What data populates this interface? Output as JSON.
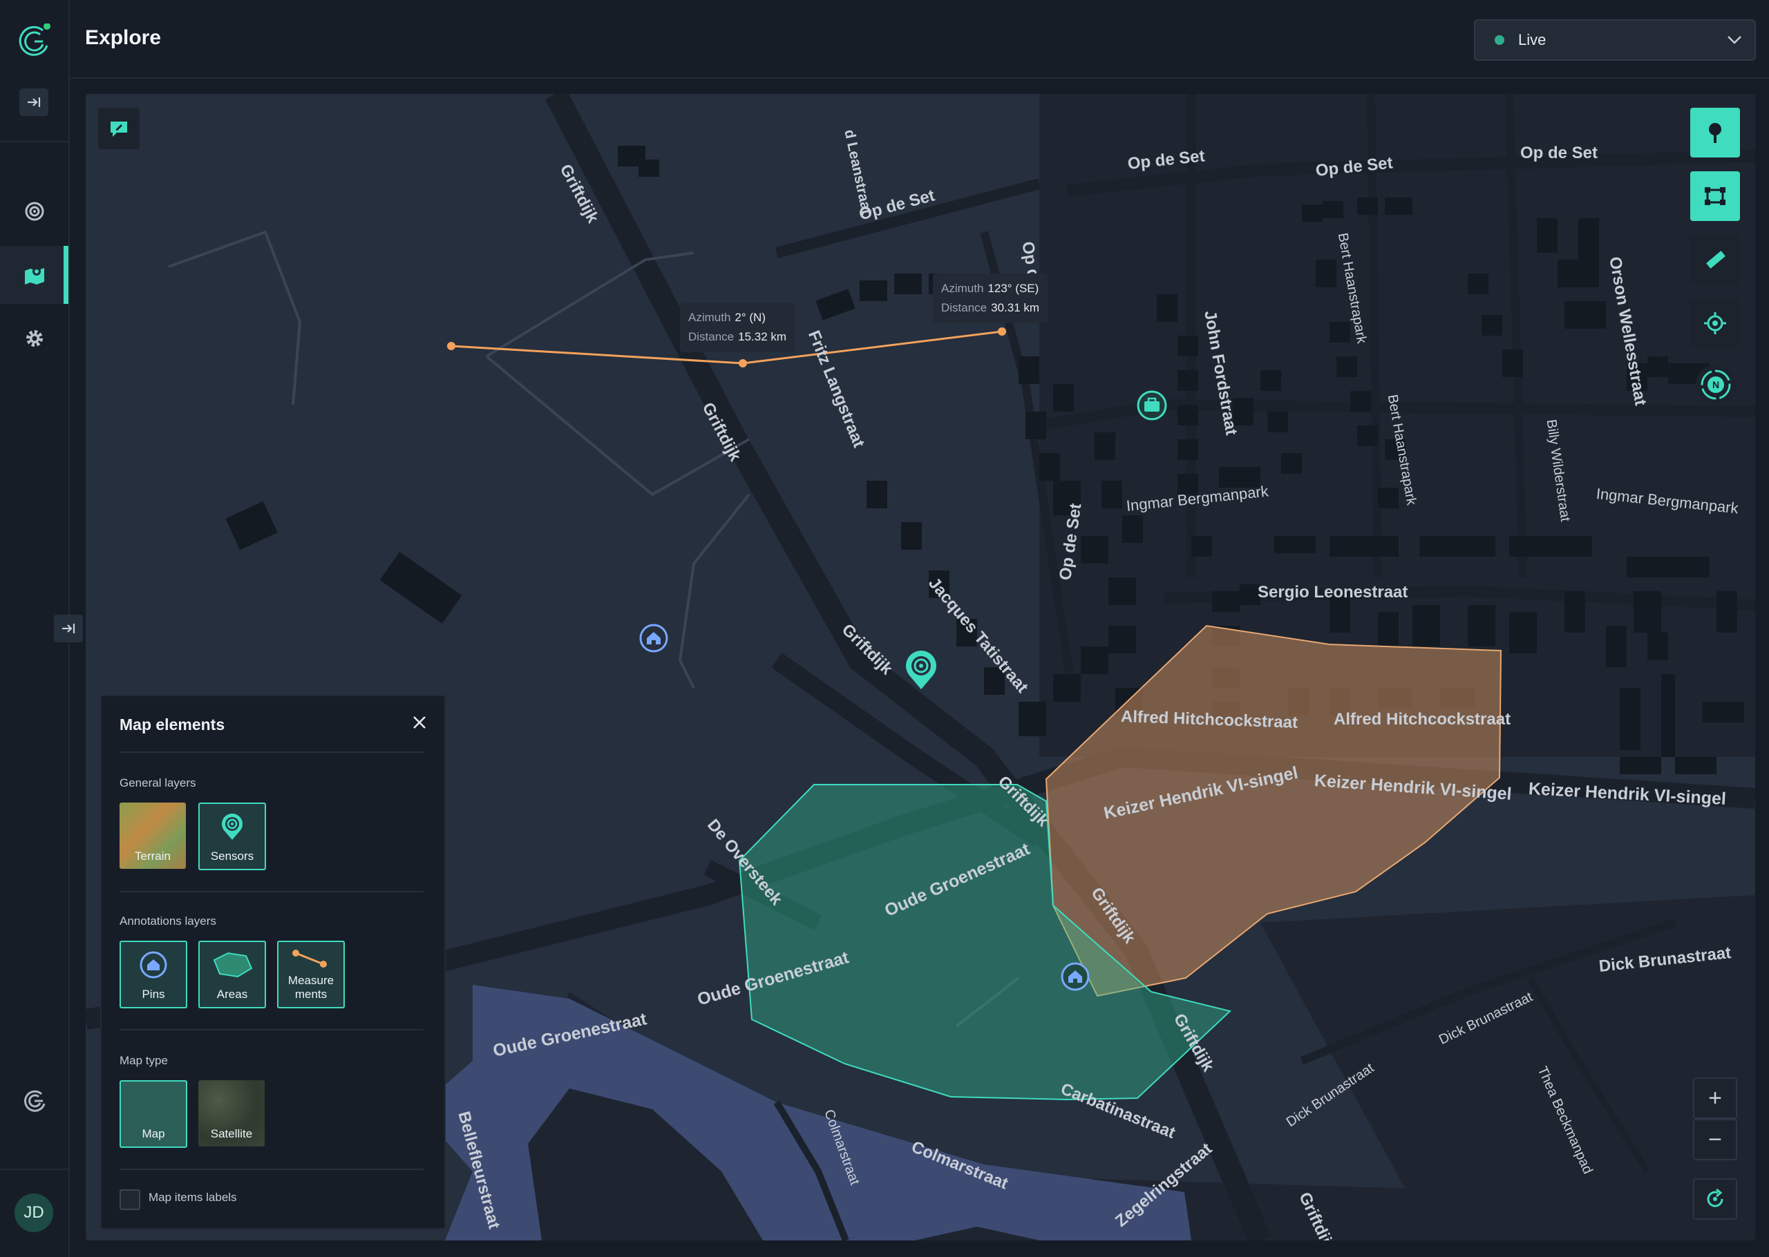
{
  "app": {
    "title": "Explore",
    "user_initials": "JD"
  },
  "mode_select": {
    "value": "Live",
    "status_color": "#2fae8e"
  },
  "nav": {
    "items": [
      "collapse-sidebar",
      "sensors-nav",
      "map-nav",
      "settings-nav"
    ],
    "active": "map-nav"
  },
  "measurements": [
    {
      "azimuth_label": "Azimuth",
      "azimuth": "2° (N)",
      "distance_label": "Distance",
      "distance": "15.32 km"
    },
    {
      "azimuth_label": "Azimuth",
      "azimuth": "123° (SE)",
      "distance_label": "Distance",
      "distance": "30.31 km"
    }
  ],
  "streets": [
    "Griftdijk",
    "Griftdijk",
    "Griftdijk",
    "Griftdijk",
    "Griftdijk",
    "Griftdijk",
    "Griftdijk",
    "Op de Set",
    "Op de Set",
    "Op de Set",
    "Op de Set",
    "Op d",
    "Op de Set",
    "d Leanstraat",
    "Fritz Langstraat",
    "John Fordstraat",
    "Bert Haanstrapark",
    "Bert Haanstrapark",
    "Orson Wellesstraat",
    "Billy Wilderstraat",
    "Ingmar Bergmanpark",
    "Ingmar Bergmanpark",
    "Sergio Leonestraat",
    "Jacques Tatistraat",
    "Alfred Hitchcockstraat",
    "Alfred Hitchcockstraat",
    "Keizer Hendrik VI-singel",
    "Keizer Hendrik VI-singel",
    "Keizer Hendrik VI-singel",
    "De Oversteek",
    "Oude Groenestraat",
    "Oude Groenestraat",
    "Oude Groenestraat",
    "Dick Brunastraat",
    "Dick Brunastraat",
    "Dick Brunastraat",
    "Thea Beckmanpad",
    "Carbatinastraat",
    "Colmarstraat",
    "Colmarstraat",
    "Zegelringstraat",
    "Bellefleurstraat"
  ],
  "panel": {
    "title": "Map elements",
    "general_layers": {
      "label": "General layers",
      "items": [
        "Terrain",
        "Sensors"
      ]
    },
    "annotations_layers": {
      "label": "Annotations layers",
      "items": [
        "Pins",
        "Areas",
        "Measure ments"
      ]
    },
    "map_type": {
      "label": "Map type",
      "items": [
        "Map",
        "Satellite"
      ]
    },
    "labels_checkbox": {
      "label": "Map items labels",
      "checked": false
    }
  },
  "controls": {
    "zoom_in": "+",
    "zoom_out": "−",
    "compass": "N"
  },
  "colors": {
    "accent": "#3fdcc0",
    "measure": "#f5a25a",
    "area_green": "#2fb88f",
    "area_orange": "#c48a5c",
    "pin_blue": "#7aa8ff",
    "water": "#3d4b73"
  }
}
